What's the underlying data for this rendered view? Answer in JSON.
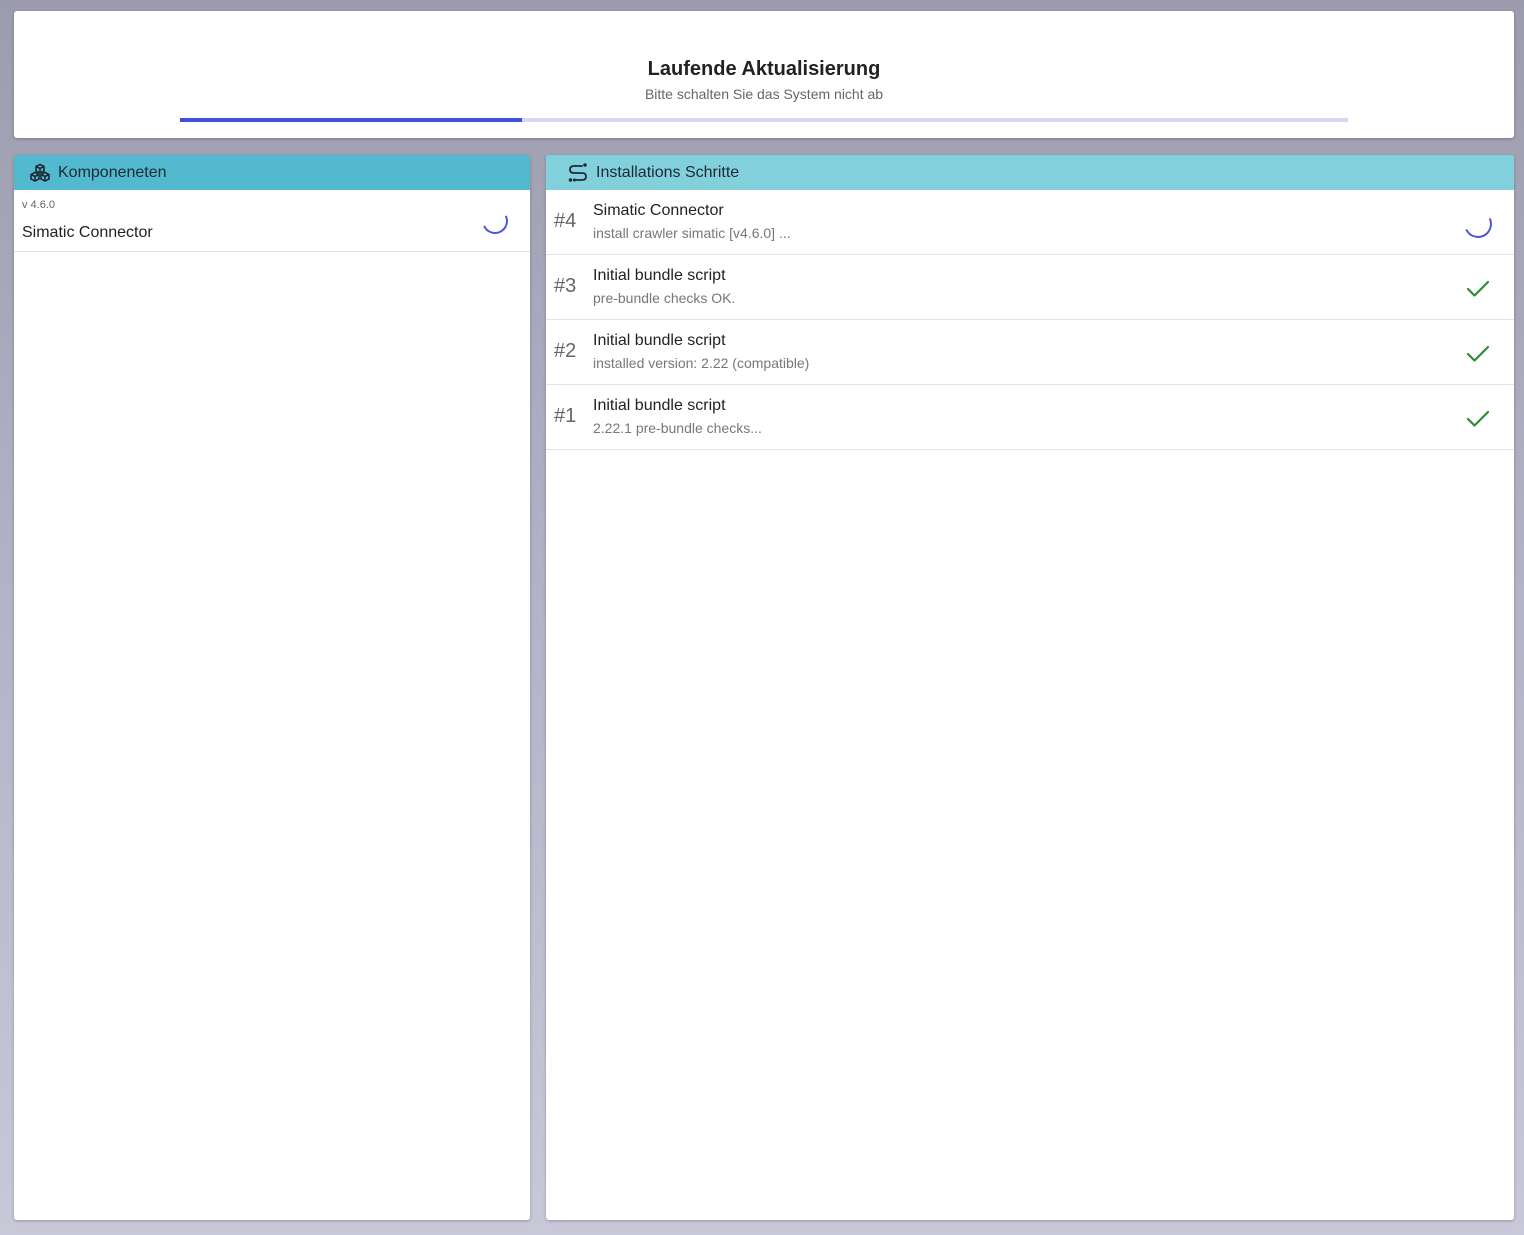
{
  "header": {
    "title": "Laufende Aktualisierung",
    "subtitle": "Bitte schalten Sie das System nicht ab",
    "progress_percent": 29.3
  },
  "components_panel": {
    "title": "Komponeneten",
    "icon": "cubes-icon",
    "items": [
      {
        "version": "v 4.6.0",
        "name": "Simatic Connector",
        "status": "loading"
      }
    ]
  },
  "steps_panel": {
    "title": "Installations Schritte",
    "icon": "route-icon",
    "steps": [
      {
        "number": "#4",
        "title": "Simatic Connector",
        "description": "install crawler simatic [v4.6.0] ...",
        "status": "loading"
      },
      {
        "number": "#3",
        "title": "Initial bundle script",
        "description": "pre-bundle checks OK.",
        "status": "done"
      },
      {
        "number": "#2",
        "title": "Initial bundle script",
        "description": "installed version: 2.22 (compatible)",
        "status": "done"
      },
      {
        "number": "#1",
        "title": "Initial bundle script",
        "description": "2.22.1 pre-bundle checks...",
        "status": "done"
      }
    ]
  },
  "colors": {
    "progress": "#3f51d1",
    "progress_track": "#d5d8f0",
    "components_header": "#52b9cf",
    "steps_header": "#82d0dc",
    "spinner": "#4a56dd",
    "check": "#2e8b2e"
  }
}
